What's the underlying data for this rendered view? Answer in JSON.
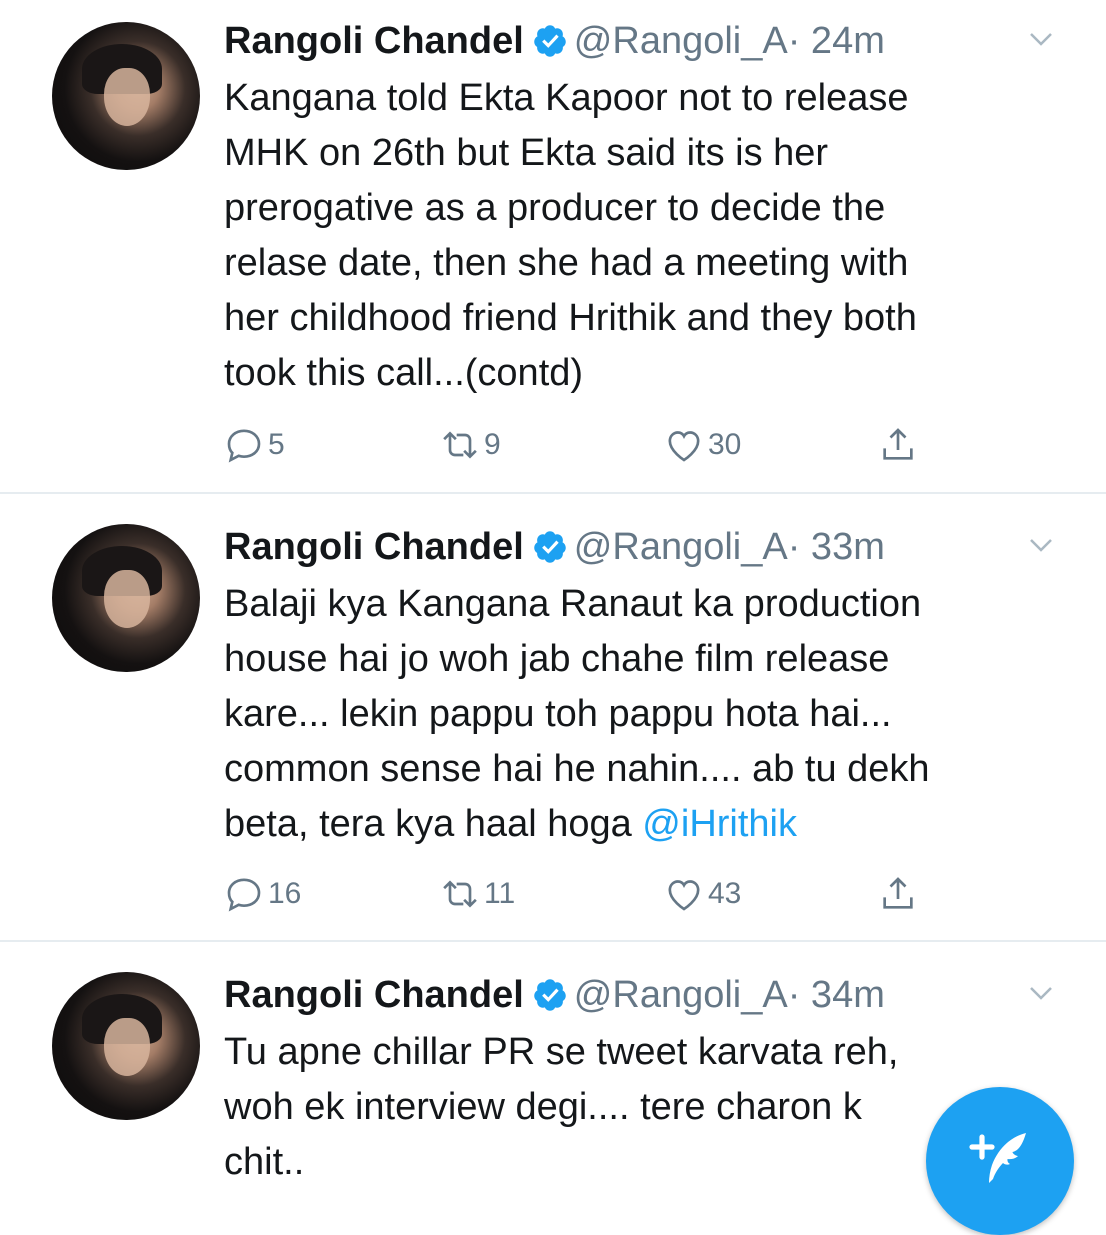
{
  "tweets": [
    {
      "name": "Rangoli Chandel",
      "handle": "@Rangoli_A",
      "time": "· 24m",
      "lines": [
        "Kangana told Ekta Kapoor not to release",
        "MHK on 26th but Ekta said its is her",
        "prerogative as a producer to decide the",
        "relase date, then she had a meeting with",
        "her childhood friend Hrithik and they both",
        "took this call...(contd)"
      ],
      "replies": "5",
      "retweets": "9",
      "likes": "30"
    },
    {
      "name": "Rangoli Chandel",
      "handle": "@Rangoli_A",
      "time": "· 33m",
      "lines": [
        "Balaji kya Kangana Ranaut ka production",
        "house hai jo woh jab chahe film release",
        "kare... lekin pappu toh pappu hota hai...",
        "common sense hai he nahin.... ab tu dekh"
      ],
      "last_line_text": "beta, tera kya haal hoga ",
      "mention": "@iHrithik",
      "replies": "16",
      "retweets": "11",
      "likes": "43"
    },
    {
      "name": "Rangoli Chandel",
      "handle": "@Rangoli_A",
      "time": "· 34m",
      "lines": [
        "Tu apne chillar PR se tweet karvata reh,",
        "woh ek interview degi.... tere charon k",
        "chit.."
      ]
    }
  ],
  "colors": {
    "accent": "#1da1f2",
    "secondary_text": "#657786",
    "divider": "#e6ecf0"
  },
  "icons": {
    "reply": "reply-icon",
    "retweet": "retweet-icon",
    "like": "heart-icon",
    "share": "share-icon",
    "caret": "chevron-down-icon",
    "verified": "verified-badge-icon",
    "compose": "compose-tweet-icon"
  }
}
